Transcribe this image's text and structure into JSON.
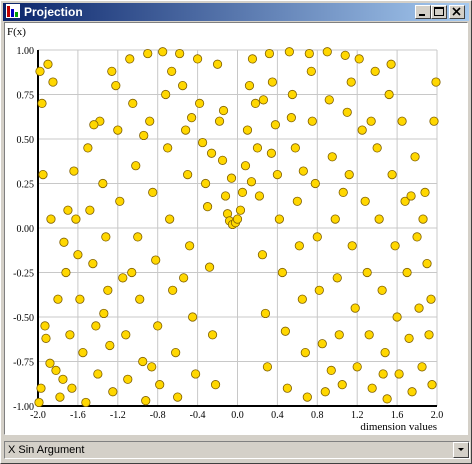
{
  "window": {
    "title": "Projection"
  },
  "controls": {
    "minimize": "minimize",
    "maximize": "maximize",
    "close": "close"
  },
  "combo": {
    "selected": "X Sin Argument"
  },
  "chart_data": {
    "type": "scatter",
    "title": "",
    "xlabel": "dimension values",
    "ylabel": "F(x)",
    "xlim": [
      -2.0,
      2.0
    ],
    "ylim": [
      -1.0,
      1.0
    ],
    "x_ticks": [
      "-2.0",
      "-1.6",
      "-1.2",
      "-0.8",
      "-0.4",
      "0.0",
      "0.4",
      "0.8",
      "1.2",
      "1.6",
      "2.0"
    ],
    "y_ticks": [
      "1.00",
      "0.75",
      "0.50",
      "0.25",
      "0.00",
      "-0.25",
      "-0.50",
      "-0.75",
      "-1.00"
    ],
    "grid": true,
    "marker_color": "#ffd700",
    "marker_edge": "#806000",
    "series": [
      {
        "values": [
          [
            -1.98,
            0.88
          ],
          [
            -1.96,
            0.7
          ],
          [
            -1.95,
            0.3
          ],
          [
            -1.93,
            -0.55
          ],
          [
            -1.97,
            -0.9
          ],
          [
            -1.99,
            -0.98
          ],
          [
            -1.9,
            0.92
          ],
          [
            -1.85,
            0.82
          ],
          [
            -1.92,
            -0.62
          ],
          [
            -1.88,
            -0.76
          ],
          [
            -1.8,
            -0.4
          ],
          [
            -1.82,
            -0.8
          ],
          [
            -1.78,
            -0.95
          ],
          [
            -1.75,
            -0.85
          ],
          [
            -1.7,
            0.1
          ],
          [
            -1.72,
            -0.25
          ],
          [
            -1.68,
            -0.6
          ],
          [
            -1.66,
            -0.9
          ],
          [
            -1.62,
            0.05
          ],
          [
            -1.6,
            -0.15
          ],
          [
            -1.58,
            -0.4
          ],
          [
            -1.55,
            -0.7
          ],
          [
            -1.52,
            -0.98
          ],
          [
            -1.5,
            0.45
          ],
          [
            -1.48,
            0.1
          ],
          [
            -1.45,
            -0.2
          ],
          [
            -1.42,
            -0.55
          ],
          [
            -1.4,
            -0.82
          ],
          [
            -1.38,
            0.6
          ],
          [
            -1.35,
            0.25
          ],
          [
            -1.32,
            -0.05
          ],
          [
            -1.3,
            -0.35
          ],
          [
            -1.28,
            -0.66
          ],
          [
            -1.25,
            -0.92
          ],
          [
            -1.22,
            0.8
          ],
          [
            -1.2,
            0.55
          ],
          [
            -1.18,
            0.15
          ],
          [
            -1.15,
            -0.28
          ],
          [
            -1.12,
            -0.6
          ],
          [
            -1.1,
            -0.85
          ],
          [
            -1.08,
            0.95
          ],
          [
            -1.05,
            0.7
          ],
          [
            -1.02,
            0.35
          ],
          [
            -1.0,
            -0.05
          ],
          [
            -0.98,
            -0.4
          ],
          [
            -0.95,
            -0.75
          ],
          [
            -0.92,
            -0.97
          ],
          [
            -0.9,
            0.98
          ],
          [
            -0.88,
            0.6
          ],
          [
            -0.85,
            0.2
          ],
          [
            -0.82,
            -0.18
          ],
          [
            -0.8,
            -0.55
          ],
          [
            -0.78,
            -0.88
          ],
          [
            -0.75,
            0.99
          ],
          [
            -0.72,
            0.75
          ],
          [
            -0.7,
            0.45
          ],
          [
            -0.68,
            0.05
          ],
          [
            -0.65,
            -0.35
          ],
          [
            -0.62,
            -0.7
          ],
          [
            -0.6,
            -0.95
          ],
          [
            -0.58,
            0.98
          ],
          [
            -0.55,
            0.8
          ],
          [
            -0.52,
            0.55
          ],
          [
            -0.5,
            0.3
          ],
          [
            -0.48,
            -0.1
          ],
          [
            -0.45,
            -0.5
          ],
          [
            -0.42,
            -0.82
          ],
          [
            -0.4,
            0.95
          ],
          [
            -0.38,
            0.7
          ],
          [
            -0.35,
            0.48
          ],
          [
            -0.32,
            0.25
          ],
          [
            -0.3,
            0.12
          ],
          [
            -0.28,
            -0.22
          ],
          [
            -0.25,
            -0.6
          ],
          [
            -0.22,
            -0.88
          ],
          [
            -0.2,
            0.92
          ],
          [
            -0.18,
            0.6
          ],
          [
            -0.15,
            0.38
          ],
          [
            -0.12,
            0.18
          ],
          [
            -0.1,
            0.08
          ],
          [
            -0.08,
            0.04
          ],
          [
            -0.05,
            0.02
          ],
          [
            -0.02,
            0.03
          ],
          [
            0.0,
            0.05
          ],
          [
            0.03,
            0.1
          ],
          [
            0.05,
            0.2
          ],
          [
            0.08,
            0.35
          ],
          [
            0.1,
            0.55
          ],
          [
            0.12,
            0.8
          ],
          [
            0.15,
            0.95
          ],
          [
            0.18,
            0.7
          ],
          [
            0.2,
            0.45
          ],
          [
            0.22,
            0.18
          ],
          [
            0.25,
            -0.15
          ],
          [
            0.28,
            -0.48
          ],
          [
            0.3,
            -0.78
          ],
          [
            0.32,
            0.98
          ],
          [
            0.35,
            0.82
          ],
          [
            0.38,
            0.58
          ],
          [
            0.4,
            0.3
          ],
          [
            0.42,
            0.05
          ],
          [
            0.45,
            -0.25
          ],
          [
            0.48,
            -0.58
          ],
          [
            0.5,
            -0.9
          ],
          [
            0.52,
            0.99
          ],
          [
            0.55,
            0.75
          ],
          [
            0.58,
            0.45
          ],
          [
            0.6,
            0.15
          ],
          [
            0.62,
            -0.1
          ],
          [
            0.65,
            -0.4
          ],
          [
            0.68,
            -0.7
          ],
          [
            0.7,
            -0.95
          ],
          [
            0.72,
            0.98
          ],
          [
            0.75,
            0.6
          ],
          [
            0.78,
            0.25
          ],
          [
            0.8,
            -0.05
          ],
          [
            0.82,
            -0.35
          ],
          [
            0.85,
            -0.65
          ],
          [
            0.88,
            -0.92
          ],
          [
            0.9,
            0.99
          ],
          [
            0.92,
            0.72
          ],
          [
            0.95,
            0.4
          ],
          [
            0.98,
            0.05
          ],
          [
            1.0,
            -0.28
          ],
          [
            1.02,
            -0.6
          ],
          [
            1.05,
            -0.88
          ],
          [
            1.08,
            0.97
          ],
          [
            1.1,
            0.65
          ],
          [
            1.12,
            0.3
          ],
          [
            1.15,
            -0.1
          ],
          [
            1.18,
            -0.45
          ],
          [
            1.2,
            -0.78
          ],
          [
            1.22,
            0.95
          ],
          [
            1.25,
            0.55
          ],
          [
            1.28,
            0.15
          ],
          [
            1.3,
            -0.25
          ],
          [
            1.32,
            -0.6
          ],
          [
            1.35,
            -0.9
          ],
          [
            1.38,
            0.88
          ],
          [
            1.4,
            0.45
          ],
          [
            1.42,
            0.05
          ],
          [
            1.45,
            -0.35
          ],
          [
            1.48,
            -0.7
          ],
          [
            1.5,
            -0.96
          ],
          [
            1.52,
            0.75
          ],
          [
            1.55,
            0.3
          ],
          [
            1.58,
            -0.1
          ],
          [
            1.6,
            -0.5
          ],
          [
            1.62,
            -0.82
          ],
          [
            1.65,
            0.6
          ],
          [
            1.68,
            0.15
          ],
          [
            1.7,
            -0.25
          ],
          [
            1.72,
            -0.62
          ],
          [
            1.75,
            -0.92
          ],
          [
            1.78,
            0.4
          ],
          [
            1.8,
            -0.05
          ],
          [
            1.82,
            -0.45
          ],
          [
            1.85,
            -0.78
          ],
          [
            1.88,
            0.2
          ],
          [
            1.9,
            -0.2
          ],
          [
            1.92,
            -0.6
          ],
          [
            1.95,
            -0.88
          ],
          [
            1.97,
            0.6
          ],
          [
            1.99,
            0.82
          ],
          [
            -1.87,
            0.05
          ],
          [
            -1.64,
            0.32
          ],
          [
            -1.44,
            0.58
          ],
          [
            -1.26,
            0.88
          ],
          [
            -1.06,
            -0.25
          ],
          [
            -0.86,
            -0.78
          ],
          [
            -0.66,
            0.88
          ],
          [
            -0.46,
            0.62
          ],
          [
            -0.26,
            0.42
          ],
          [
            -0.06,
            0.28
          ],
          [
            0.14,
            0.26
          ],
          [
            0.34,
            0.42
          ],
          [
            0.54,
            0.62
          ],
          [
            0.74,
            0.88
          ],
          [
            0.94,
            -0.8
          ],
          [
            1.14,
            0.82
          ],
          [
            1.34,
            0.6
          ],
          [
            1.54,
            0.92
          ],
          [
            1.74,
            0.18
          ],
          [
            1.94,
            -0.4
          ],
          [
            -1.74,
            -0.08
          ],
          [
            -1.34,
            -0.48
          ],
          [
            -0.94,
            0.52
          ],
          [
            -0.54,
            -0.28
          ],
          [
            -0.14,
            0.66
          ],
          [
            0.26,
            0.72
          ],
          [
            0.66,
            0.32
          ],
          [
            1.06,
            0.2
          ],
          [
            1.46,
            -0.82
          ],
          [
            1.86,
            0.05
          ]
        ]
      }
    ]
  }
}
